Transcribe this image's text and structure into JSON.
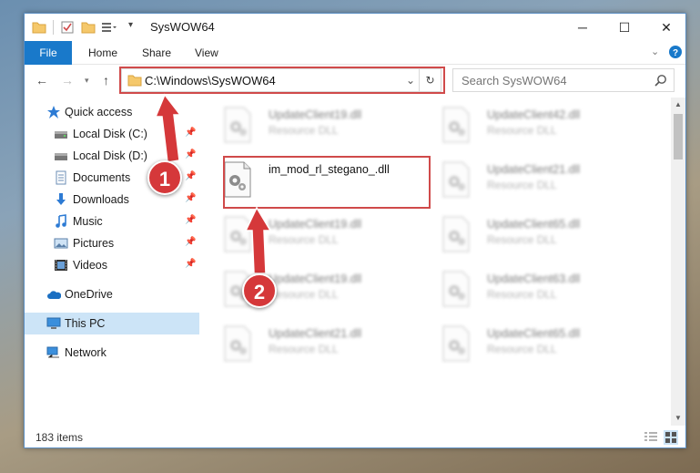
{
  "window": {
    "title": "SysWOW64",
    "minimize_label": "─",
    "maximize_label": "☐",
    "close_label": "✕"
  },
  "ribbon": {
    "tabs": [
      "File",
      "Home",
      "Share",
      "View"
    ]
  },
  "address": {
    "path": "C:\\Windows\\SysWOW64"
  },
  "search": {
    "placeholder": "Search SysWOW64"
  },
  "nav_pane": {
    "items": [
      {
        "label": "Quick access",
        "icon": "star-icon"
      },
      {
        "label": "Local Disk (C:)",
        "icon": "drive-icon",
        "pinned": true
      },
      {
        "label": "Local Disk (D:)",
        "icon": "drive-icon",
        "pinned": true
      },
      {
        "label": "Documents",
        "icon": "documents-icon",
        "pinned": true
      },
      {
        "label": "Downloads",
        "icon": "download-icon",
        "pinned": true
      },
      {
        "label": "Music",
        "icon": "music-icon",
        "pinned": true
      },
      {
        "label": "Pictures",
        "icon": "pictures-icon",
        "pinned": true
      },
      {
        "label": "Videos",
        "icon": "videos-icon",
        "pinned": true
      },
      {
        "label": "OneDrive",
        "icon": "cloud-icon"
      },
      {
        "label": "This PC",
        "icon": "computer-icon",
        "selected": true
      },
      {
        "label": "Network",
        "icon": "network-icon"
      }
    ]
  },
  "files": [
    {
      "name": "UpdateClient19.dll",
      "type": "Resource DLL",
      "blurred": true
    },
    {
      "name": "UpdateClient42.dll",
      "type": "Resource DLL",
      "blurred": true
    },
    {
      "name": "im_mod_rl_stegano_.dll",
      "type": "",
      "blurred": false,
      "highlighted": true
    },
    {
      "name": "UpdateClient21.dll",
      "type": "Resource DLL",
      "blurred": true
    },
    {
      "name": "UpdateClient19.dll",
      "type": "Resource DLL",
      "blurred": true
    },
    {
      "name": "UpdateClient65.dll",
      "type": "Resource DLL",
      "blurred": true
    },
    {
      "name": "UpdateClient19.dll",
      "type": "Resource DLL",
      "blurred": true
    },
    {
      "name": "UpdateClient63.dll",
      "type": "Resource DLL",
      "blurred": true
    },
    {
      "name": "UpdateClient21.dll",
      "type": "Resource DLL",
      "blurred": true
    },
    {
      "name": "UpdateClient65.dll",
      "type": "Resource DLL",
      "blurred": true
    }
  ],
  "status": {
    "item_count": "183 items"
  },
  "callouts": [
    "1",
    "2"
  ],
  "colors": {
    "accent": "#1979ca",
    "highlight": "#d04a4a",
    "callout": "#d5383a",
    "selected": "#cce4f7"
  }
}
